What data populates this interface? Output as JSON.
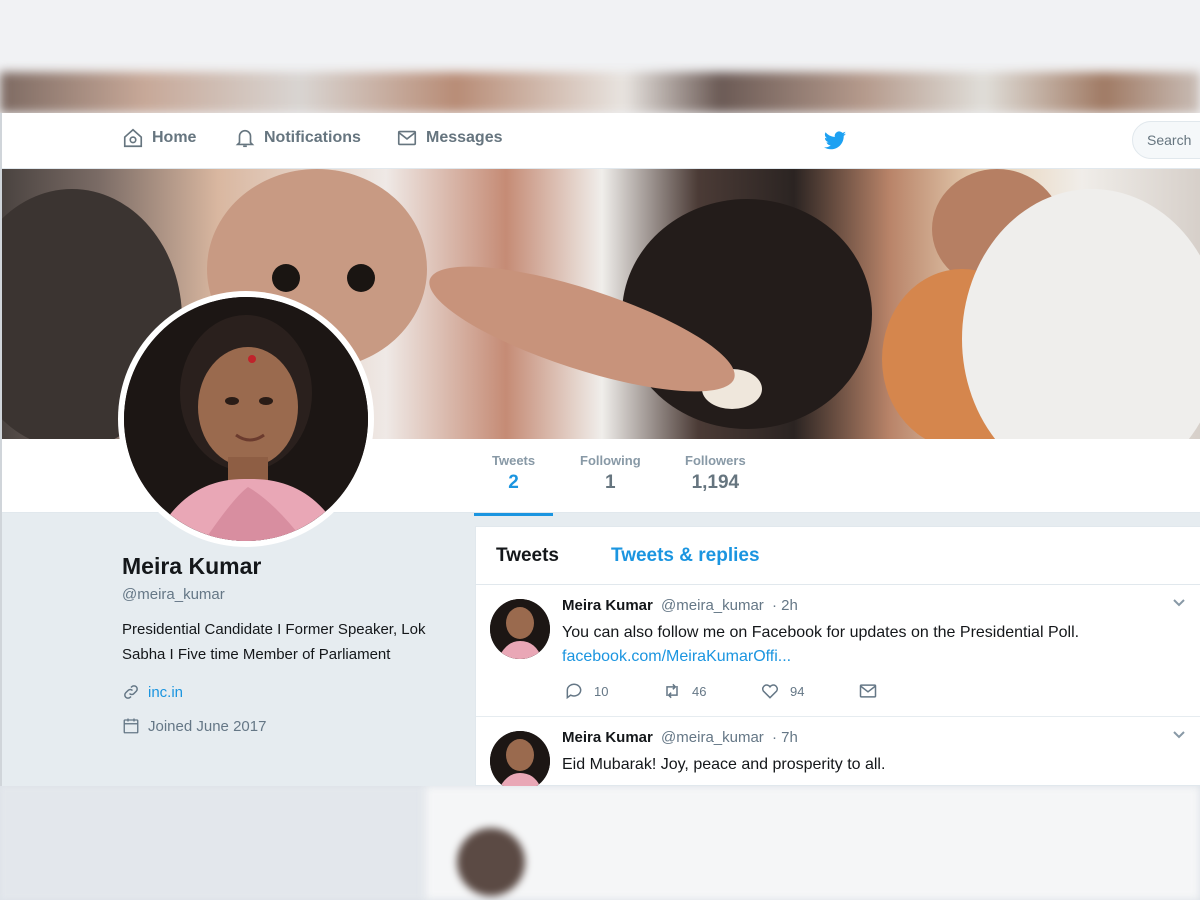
{
  "nav": {
    "home": "Home",
    "notifications": "Notifications",
    "messages": "Messages",
    "search_placeholder": "Search"
  },
  "profile": {
    "name": "Meira Kumar",
    "handle": "@meira_kumar",
    "bio": "Presidential Candidate I Former Speaker, Lok Sabha I Five time Member of Parliament",
    "website": "inc.in",
    "joined": "Joined June 2017"
  },
  "stats": [
    {
      "label": "Tweets",
      "value": "2"
    },
    {
      "label": "Following",
      "value": "1"
    },
    {
      "label": "Followers",
      "value": "1,194"
    }
  ],
  "tabs": {
    "tweets": "Tweets",
    "replies": "Tweets & replies"
  },
  "tweets": [
    {
      "name": "Meira Kumar",
      "handle": "@meira_kumar",
      "time": "· 2h",
      "text": "You can also follow me on Facebook for updates on the Presidential Poll.",
      "link": "facebook.com/MeiraKumarOffi...",
      "replies": "10",
      "retweets": "46",
      "likes": "94"
    },
    {
      "name": "Meira Kumar",
      "handle": "@meira_kumar",
      "time": "· 7h",
      "text": "Eid Mubarak! Joy, peace and prosperity to all."
    }
  ],
  "colors": {
    "accent": "#1b95e0",
    "muted": "#657786",
    "text": "#14171a",
    "background": "#e6ecf0"
  }
}
